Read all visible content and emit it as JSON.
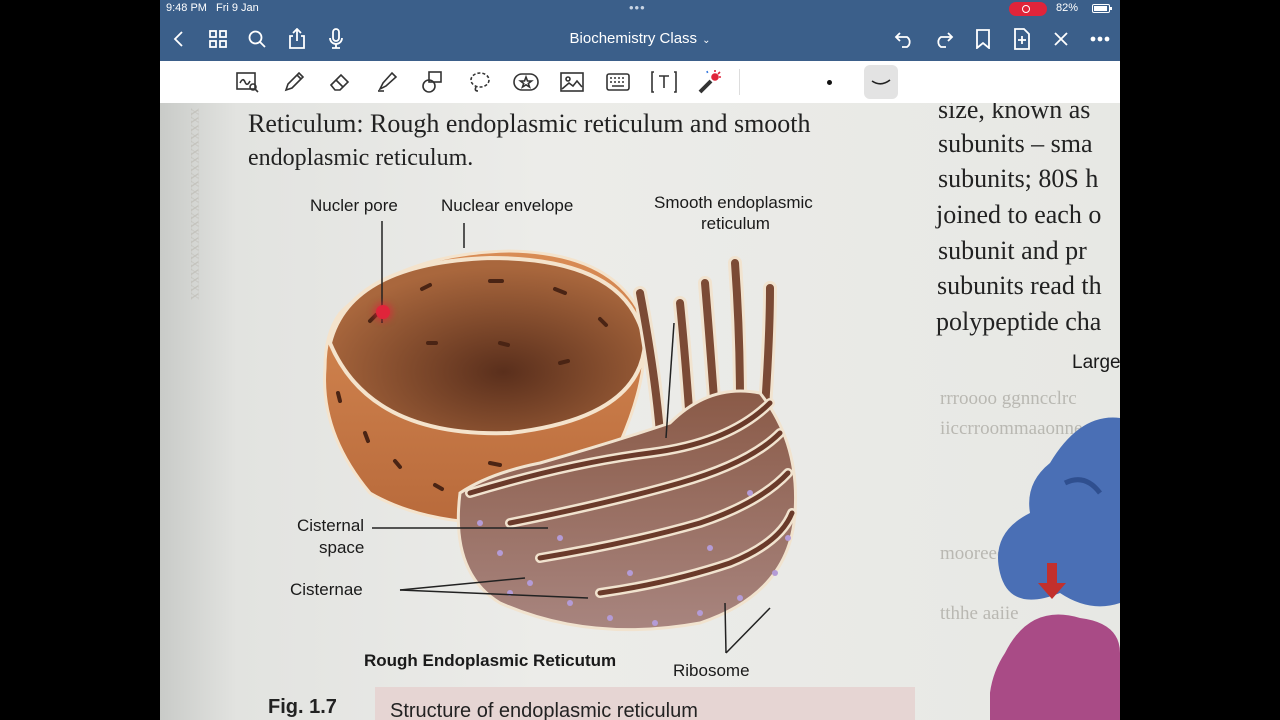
{
  "status": {
    "time": "9:48 PM",
    "date": "Fri 9 Jan",
    "battery": "82%"
  },
  "nav": {
    "title": "Biochemistry Class",
    "icons": [
      "back-icon",
      "grid-icon",
      "search-icon",
      "share-icon",
      "mic-icon",
      "undo-icon",
      "redo-icon",
      "bookmark-icon",
      "add-page-icon",
      "close-icon",
      "more-icon"
    ]
  },
  "toolbar": {
    "tools": [
      "zoom-note-tool",
      "pen-tool",
      "eraser-tool",
      "highlighter-tool",
      "shapes-tool",
      "lasso-tool",
      "sticker-tool",
      "image-tool",
      "keyboard-tool",
      "text-tool",
      "laser-pointer-tool"
    ]
  },
  "page": {
    "heading_line1": "Reticulum: Rough endoplasmic reticulum and smooth",
    "heading_line2": "endoplasmic reticulum.",
    "right_col": [
      "size, known as",
      "subunits – sma",
      "subunits; 80S h",
      "joined to each o",
      "subunit and pr",
      "subunits read th",
      "polypeptide cha"
    ],
    "right_label": "Large",
    "labels": {
      "nuclear_pore": "Nucler pore",
      "nuclear_envelope": "Nuclear envelope",
      "ser_line1": "Smooth endoplasmic",
      "ser_line2": "reticulum",
      "cisternal_line1": "Cisternal",
      "cisternal_line2": "space",
      "cisternae": "Cisternae",
      "rer": "Rough Endoplasmic Reticutum",
      "ribosome": "Ribosome"
    },
    "fig_num": "Fig. 1.7",
    "fig_caption": "Structure of endoplasmic reticulum"
  },
  "colors": {
    "bar": "#3b5f8a",
    "accent_red": "#e0243a"
  }
}
